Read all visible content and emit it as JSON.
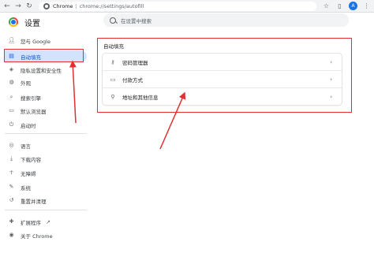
{
  "browser": {
    "site_label": "Chrome",
    "url": "chrome://settings/autofill",
    "avatar_letter": "A"
  },
  "header": {
    "title": "设置",
    "search_placeholder": "在设置中搜索"
  },
  "sidebar": {
    "items": [
      {
        "label": "您与 Google",
        "icon": "person-icon"
      },
      {
        "label": "自动填充",
        "icon": "autofill-icon"
      },
      {
        "label": "隐私设置和安全性",
        "icon": "shield-icon"
      },
      {
        "label": "外观",
        "icon": "palette-icon"
      },
      {
        "label": "搜索引擎",
        "icon": "search-icon"
      },
      {
        "label": "默认浏览器",
        "icon": "browser-icon"
      },
      {
        "label": "启动时",
        "icon": "power-icon"
      },
      {
        "label": "语言",
        "icon": "globe-icon"
      },
      {
        "label": "下载内容",
        "icon": "download-icon"
      },
      {
        "label": "无障碍",
        "icon": "accessibility-icon"
      },
      {
        "label": "系统",
        "icon": "wrench-icon"
      },
      {
        "label": "重置并清理",
        "icon": "reset-icon"
      },
      {
        "label": "扩展程序",
        "icon": "puzzle-icon"
      },
      {
        "label": "关于 Chrome",
        "icon": "chrome-icon"
      }
    ]
  },
  "main": {
    "section_title": "自动填充",
    "rows": [
      {
        "label": "密码管理器",
        "icon": "key-icon"
      },
      {
        "label": "付款方式",
        "icon": "card-icon"
      },
      {
        "label": "地址和其他信息",
        "icon": "location-pin-icon"
      }
    ]
  },
  "colors": {
    "accent": "#0b57d0",
    "active_bg": "#d3e3fd",
    "annotation_red": "#e03030"
  }
}
